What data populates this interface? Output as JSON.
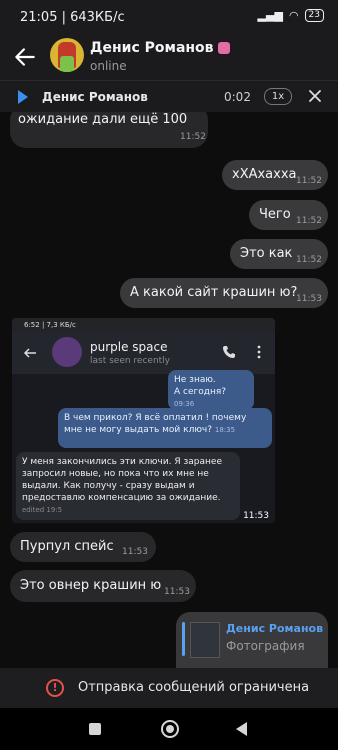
{
  "statusbar": {
    "time_speed": "21:05 | 643КБ/с",
    "battery": "23"
  },
  "header": {
    "name": "Денис Романов",
    "status": "online"
  },
  "player": {
    "name": "Денис Романов",
    "time": "0:02",
    "speed": "1x"
  },
  "messages": {
    "m1": {
      "text": "ожидание дали ещё 100",
      "time": "11:52"
    },
    "m2": {
      "text": "хХАхахха",
      "time": "11:52"
    },
    "m3": {
      "text": "Чего",
      "time": "11:52"
    },
    "m4": {
      "text": "Это как",
      "time": "11:52"
    },
    "m5": {
      "text": "А какой сайт крашин ю?",
      "time": "11:53"
    },
    "m7": {
      "text": "Пурпул спейс",
      "time": "11:53"
    },
    "m8": {
      "text": "Это овнер крашин ю",
      "time": "11:53"
    }
  },
  "screenshot": {
    "status_left": "6:52 | 7,3 КБ/с",
    "chat_name": "purple space",
    "chat_status": "last seen recently",
    "msg_a": "Не знаю.",
    "msg_b": "А сегодня?",
    "msg_b_time": "09:36",
    "msg_c": "В чем прикол? Я всё оплатил ! почему мне не могу выдать мой ключ?",
    "msg_c_time": "18:35",
    "msg_d": "У меня закончились эти ключи. Я заранее запросил новые, но пока что их мне не выдали. Как получу - сразу выдам и предоставлю компенсацию за ожидание.",
    "msg_d_time": "edited 19:5",
    "bubble_time": "11:53"
  },
  "reply": {
    "name": "Денис Романов",
    "type": "Фотография"
  },
  "restriction": {
    "text": "Отправка сообщений ограничена"
  }
}
